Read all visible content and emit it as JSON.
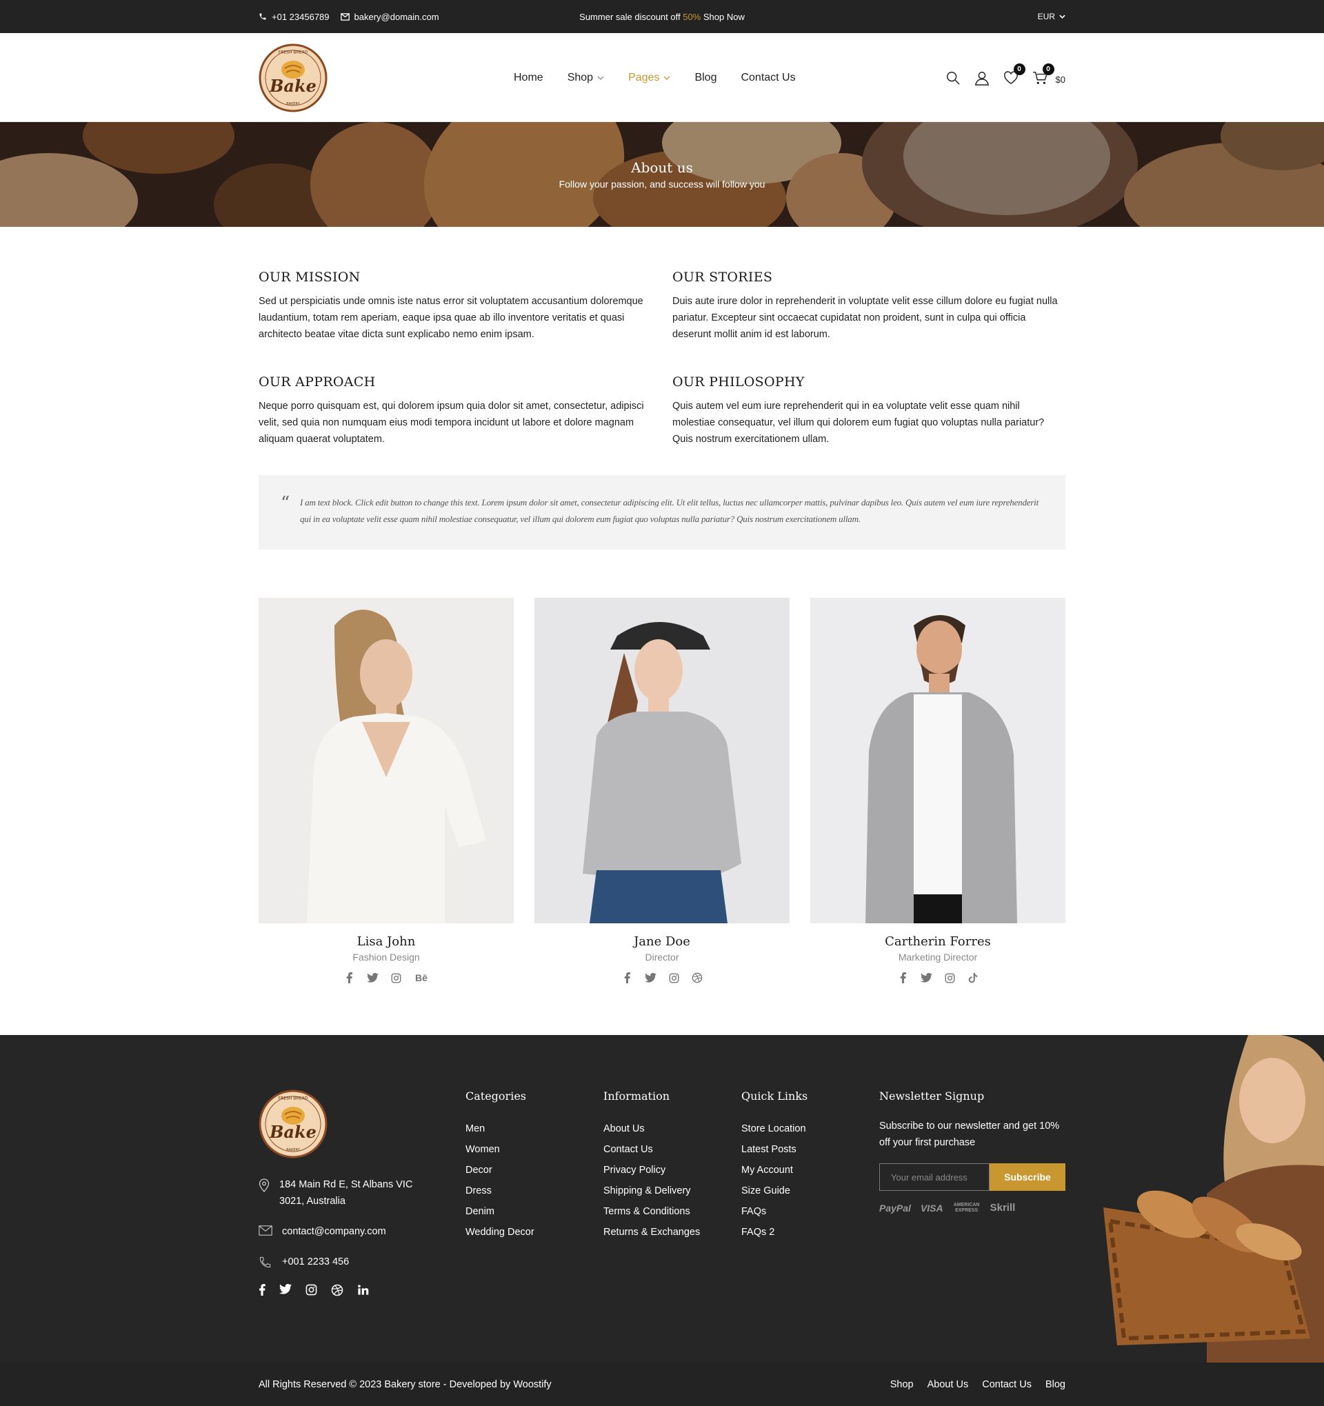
{
  "topbar": {
    "phone": "+01 23456789",
    "email": "bakery@domain.com",
    "promo_prefix": "Summer sale discount off ",
    "promo_highlight": "50%",
    "promo_suffix": " Shop Now",
    "currency": "EUR"
  },
  "header": {
    "logo": {
      "top_text": "FRESH BREAD",
      "main_text": "Bake",
      "bottom_text": "BAKERY"
    },
    "nav": [
      {
        "label": "Home"
      },
      {
        "label": "Shop"
      },
      {
        "label": "Pages"
      },
      {
        "label": "Blog"
      },
      {
        "label": "Contact Us"
      }
    ],
    "wishlist_count": "0",
    "cart_count": "0",
    "cart_total": "$0"
  },
  "hero": {
    "title": "About us",
    "subtitle": "Follow your passion, and success will follow you"
  },
  "info": [
    {
      "heading": "OUR MISSION",
      "text": "Sed ut perspiciatis unde omnis iste natus error sit voluptatem accusantium doloremque laudantium, totam rem aperiam, eaque ipsa quae ab illo inventore veritatis et quasi architecto beatae vitae dicta sunt explicabo nemo enim ipsam."
    },
    {
      "heading": "OUR STORIES",
      "text": "Duis aute irure dolor in reprehenderit in voluptate velit esse cillum dolore eu fugiat nulla pariatur. Excepteur sint occaecat cupidatat non proident, sunt in culpa qui officia deserunt mollit anim id est laborum."
    },
    {
      "heading": "OUR APPROACH",
      "text": "Neque porro quisquam est, qui dolorem ipsum quia dolor sit amet, consectetur, adipisci velit, sed quia non numquam eius modi tempora incidunt ut labore et dolore magnam aliquam quaerat voluptatem."
    },
    {
      "heading": "OUR PHILOSOPHY",
      "text": "Quis autem vel eum iure reprehenderit qui in ea voluptate velit esse quam nihil molestiae consequatur, vel illum qui dolorem eum fugiat quo voluptas nulla pariatur? Quis nostrum exercitationem ullam."
    }
  ],
  "quote": {
    "text": "I am text block. Click edit button to change this text. Lorem ipsum dolor sit amet, consectetur adipiscing elit. Ut elit tellus, luctus nec ullamcorper mattis, pulvinar dapibus leo. Quis autem vel eum iure reprehenderit qui in ea voluptate velit esse quam nihil molestiae consequatur, vel illum qui dolorem eum fugiat quo voluptas nulla pariatur? Quis nostrum exercitationem ullam."
  },
  "team": [
    {
      "name": "Lisa John",
      "role": "Fashion Design",
      "socials": [
        "facebook-icon",
        "twitter-icon",
        "instagram-icon",
        "behance-icon"
      ]
    },
    {
      "name": "Jane Doe",
      "role": "Director",
      "socials": [
        "facebook-icon",
        "twitter-icon",
        "instagram-icon",
        "dribbble-icon"
      ]
    },
    {
      "name": "Cartherin Forres",
      "role": "Marketing Director",
      "socials": [
        "facebook-icon",
        "twitter-icon",
        "instagram-icon",
        "tiktok-icon"
      ]
    }
  ],
  "footer": {
    "address": "184 Main Rd E, St Albans VIC 3021, Australia",
    "email": "contact@company.com",
    "phone": "+001 2233 456",
    "categories": {
      "title": "Categories",
      "items": [
        "Men",
        "Women",
        "Decor",
        "Dress",
        "Denim",
        "Wedding Decor"
      ]
    },
    "information": {
      "title": "Information",
      "items": [
        "About Us",
        "Contact Us",
        "Privacy Policy",
        "Shipping & Delivery",
        "Terms & Conditions",
        "Returns & Exchanges"
      ]
    },
    "quick_links": {
      "title": "Quick Links",
      "items": [
        "Store Location",
        "Latest Posts",
        "My Account",
        "Size Guide",
        "FAQs",
        "FAQs 2"
      ]
    },
    "newsletter": {
      "title": "Newsletter Signup",
      "text": "Subscribe to our newsletter and get 10% off your first purchase",
      "placeholder": "Your email address",
      "button": "Subscribe",
      "payments": [
        "PayPal",
        "VISA",
        "AMERICAN EXPRESS",
        "Skrill"
      ]
    }
  },
  "bottombar": {
    "copyright": "All Rights Reserved © 2023 Bakery store - Developed by Woostify",
    "links": [
      "Shop",
      "About Us",
      "Contact Us",
      "Blog"
    ]
  },
  "colors": {
    "accent": "#c8972f",
    "dark": "#232323",
    "footer_bg": "#262626"
  }
}
